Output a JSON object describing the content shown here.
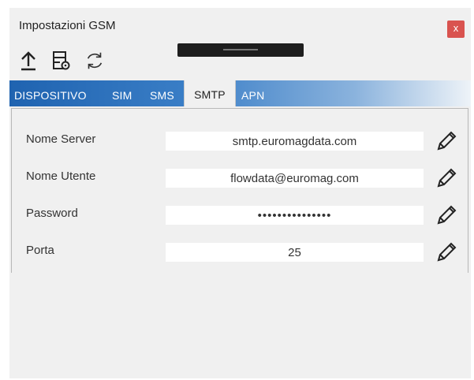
{
  "window": {
    "title": "Impostazioni GSM",
    "close_label": "x"
  },
  "tabs": [
    {
      "label": "DISPOSITIVO",
      "active": false
    },
    {
      "label": "SIM",
      "active": false
    },
    {
      "label": "SMS",
      "active": false
    },
    {
      "label": "SMTP",
      "active": true
    },
    {
      "label": "APN",
      "active": false
    }
  ],
  "toolbar": {
    "icons": [
      "upload-icon",
      "settings-file-icon",
      "refresh-icon"
    ]
  },
  "smtp": {
    "rows": [
      {
        "label": "Nome Server",
        "value": "smtp.euromagdata.com"
      },
      {
        "label": "Nome Utente",
        "value": "flowdata@euromag.com"
      },
      {
        "label": "Password",
        "value": "•••••••••••••••"
      },
      {
        "label": "Porta",
        "value": "25"
      }
    ]
  },
  "colors": {
    "tab_gradient_start": "#1f63b0",
    "close_button": "#d9534f",
    "background": "#f0f0f0"
  }
}
